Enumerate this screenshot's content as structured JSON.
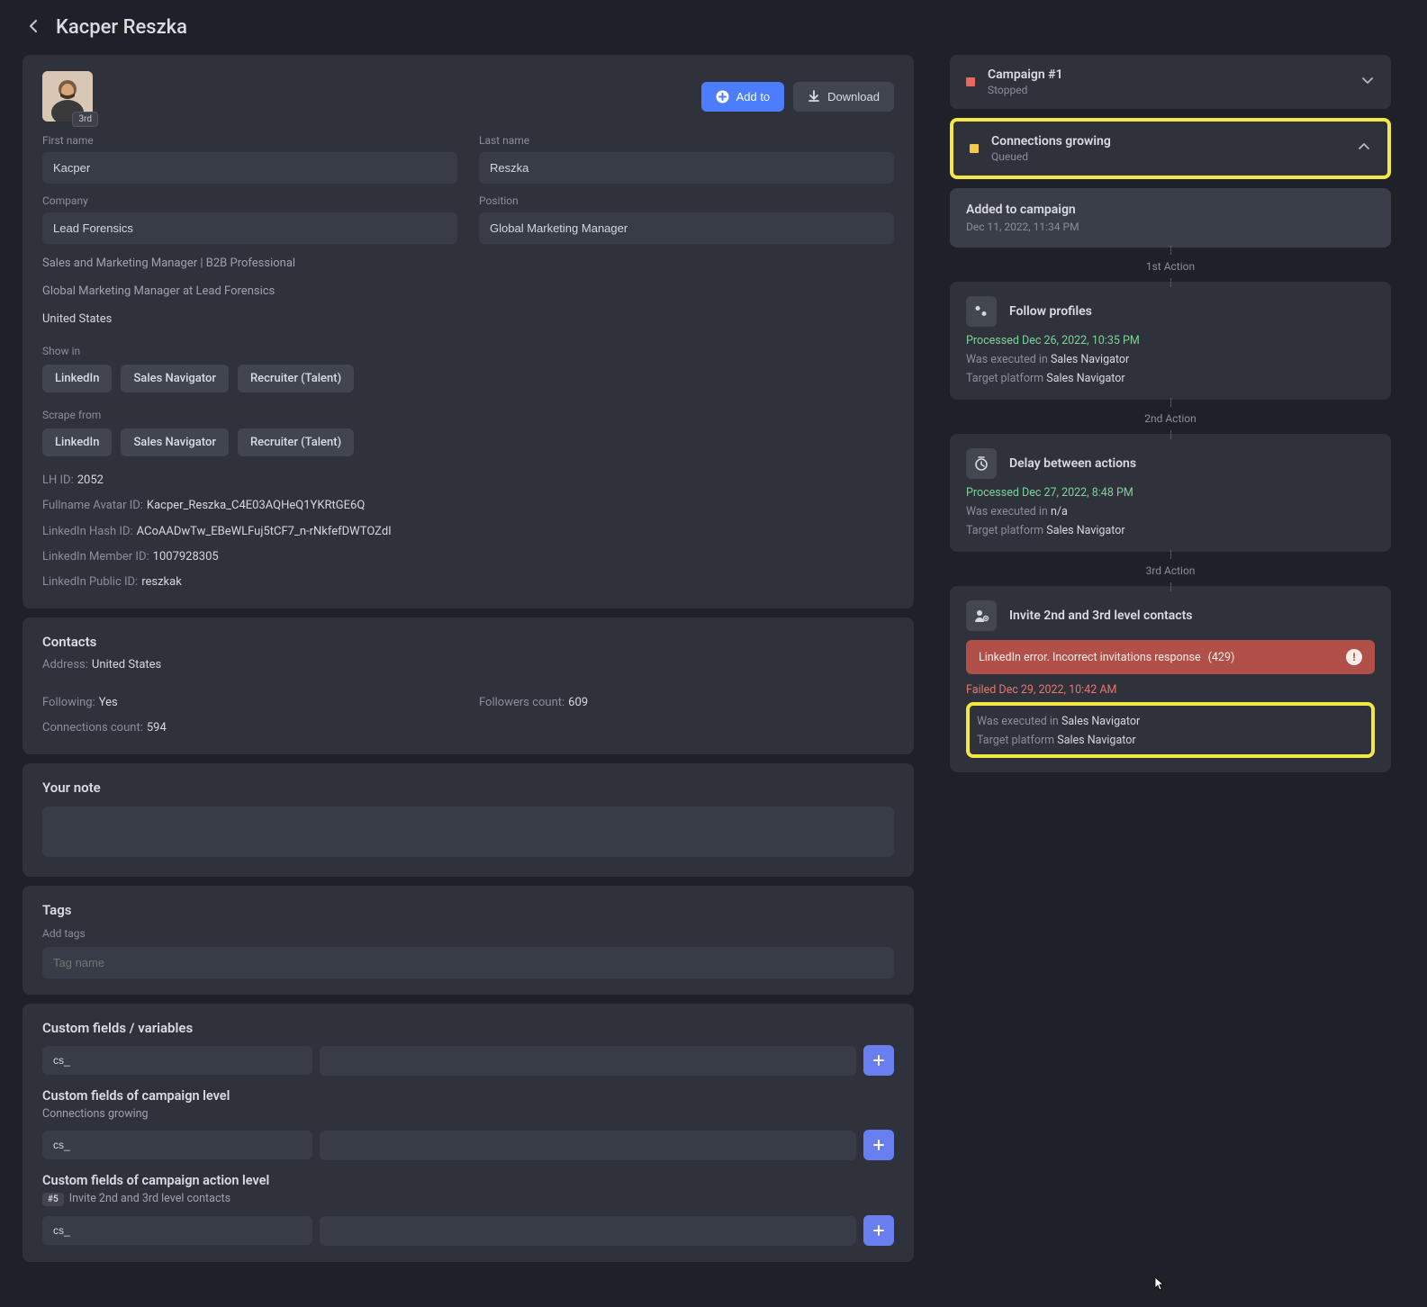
{
  "header": {
    "title": "Kacper Reszka"
  },
  "profile": {
    "avatar_badge": "3rd",
    "buttons": {
      "add_to": "Add to",
      "download": "Download"
    },
    "fields": {
      "first_name_label": "First name",
      "first_name": "Kacper",
      "last_name_label": "Last name",
      "last_name": "Reszka",
      "company_label": "Company",
      "company": "Lead Forensics",
      "position_label": "Position",
      "position": "Global Marketing Manager"
    },
    "headline": "Sales and Marketing Manager | B2B Professional",
    "subline": "Global Marketing Manager at Lead Forensics",
    "location": "United States",
    "show_in_label": "Show in",
    "scrape_from_label": "Scrape from",
    "platforms": {
      "linkedin": "LinkedIn",
      "sales_nav": "Sales Navigator",
      "recruiter": "Recruiter (Talent)"
    },
    "ids": {
      "lh_id_label": "LH ID:",
      "lh_id": "2052",
      "avatar_id_label": "Fullname Avatar ID:",
      "avatar_id": "Kacper_Reszka_C4E03AQHeQ1YKRtGE6Q",
      "hash_id_label": "LinkedIn Hash ID:",
      "hash_id": "ACoAADwTw_EBeWLFuj5tCF7_n-rNkfefDWTOZdI",
      "member_id_label": "LinkedIn Member ID:",
      "member_id": "1007928305",
      "public_id_label": "LinkedIn Public ID:",
      "public_id": "reszkak"
    }
  },
  "contacts": {
    "title": "Contacts",
    "address_label": "Address:",
    "address": "United States",
    "following_label": "Following:",
    "following": "Yes",
    "followers_label": "Followers count:",
    "followers": "609",
    "connections_label": "Connections count:",
    "connections": "594"
  },
  "note": {
    "title": "Your note"
  },
  "tags": {
    "title": "Tags",
    "add_label": "Add tags",
    "placeholder": "Tag name"
  },
  "custom_fields": {
    "title": "Custom fields / variables",
    "cs_prefix": "cs_",
    "campaign_level_title": "Custom fields of campaign level",
    "campaign_level_sub": "Connections growing",
    "action_level_title": "Custom fields of campaign action level",
    "action_num": "#5",
    "action_level_sub": "Invite 2nd and 3rd level contacts"
  },
  "campaigns": [
    {
      "name": "Campaign #1",
      "status": "Stopped",
      "color": "dot-red",
      "expanded": false,
      "highlight": false
    },
    {
      "name": "Connections growing",
      "status": "Queued",
      "color": "dot-yellow",
      "expanded": true,
      "highlight": true
    }
  ],
  "timeline": {
    "added": {
      "title": "Added to campaign",
      "ts": "Dec 11, 2022, 11:34 PM"
    },
    "marker1": "1st Action",
    "action1": {
      "title": "Follow profiles",
      "processed_label": "Processed",
      "processed_ts": "Dec 26, 2022, 10:35 PM",
      "exec_label": "Was executed in",
      "exec_val": "Sales Navigator",
      "target_label": "Target platform",
      "target_val": "Sales Navigator"
    },
    "marker2": "2nd Action",
    "action2": {
      "title": "Delay between actions",
      "processed_label": "Processed",
      "processed_ts": "Dec 27, 2022, 8:48 PM",
      "exec_label": "Was executed in",
      "exec_val": "n/a",
      "target_label": "Target platform",
      "target_val": "Sales Navigator"
    },
    "marker3": "3rd Action",
    "action3": {
      "title": "Invite 2nd and 3rd level contacts",
      "error_text": "LinkedIn error. Incorrect invitations response",
      "error_code": "(429)",
      "failed_label": "Failed",
      "failed_ts": "Dec 29, 2022, 10:42 AM",
      "exec_label": "Was executed in",
      "exec_val": "Sales Navigator",
      "target_label": "Target platform",
      "target_val": "Sales Navigator"
    }
  }
}
